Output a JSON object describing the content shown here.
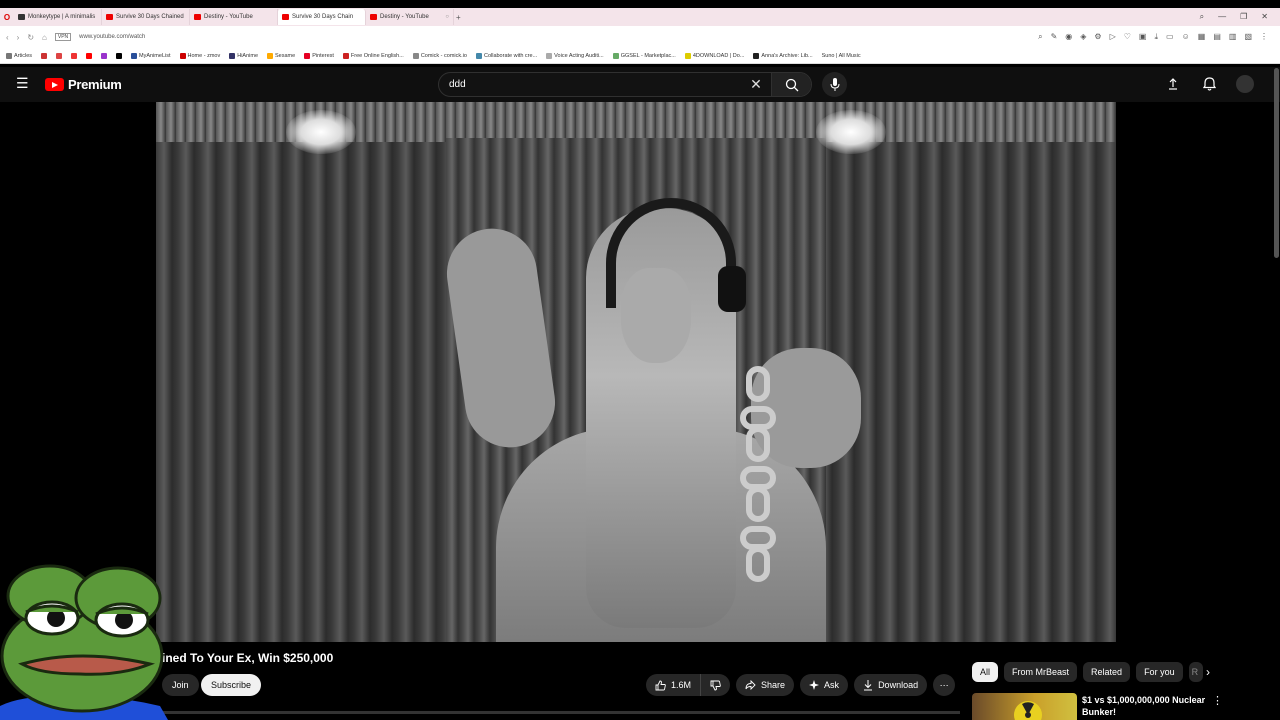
{
  "browser": {
    "tabs": [
      {
        "title": "Monkeytype | A minimalis",
        "active": false
      },
      {
        "title": "Survive 30 Days Chained",
        "active": false
      },
      {
        "title": "Destiny - YouTube",
        "active": false
      },
      {
        "title": "Survive 30 Days Chain",
        "active": true
      },
      {
        "title": "Destiny - YouTube",
        "active": false
      }
    ],
    "new_tab": "+",
    "url": "www.youtube.com/watch",
    "vpn_label": "VPN",
    "bookmarks": [
      "Articles",
      "MyAnimeList",
      "Home - zmov",
      "HiAnime",
      "Sesame",
      "Pinterest",
      "Free Online English...",
      "Comick - comick.io",
      "Collaborate with cre...",
      "Voice Acting Auditi...",
      "GGSEL - Marketplac...",
      "4DOWNLOAD | Do...",
      "Anna's Archive: Lib...",
      "Suno | All Music"
    ]
  },
  "youtube": {
    "logo_text": "Premium",
    "search": {
      "value": "ddd"
    },
    "video": {
      "title": "ined To Your Ex, Win $250,000",
      "join_label": "Join",
      "subscribe_label": "Subscribe",
      "like_count": "1.6M",
      "share_label": "Share",
      "ask_label": "Ask",
      "download_label": "Download"
    },
    "chips": [
      {
        "label": "All",
        "active": true
      },
      {
        "label": "From MrBeast",
        "active": false
      },
      {
        "label": "Related",
        "active": false
      },
      {
        "label": "For you",
        "active": false
      },
      {
        "label": "R",
        "active": false
      }
    ],
    "recommendation": {
      "title": "$1 vs $1,000,000,000 Nuclear Bunker!"
    }
  },
  "colors": {
    "brand_red": "#ff0000",
    "background": "#0f0f0f",
    "chip_bg": "#272727"
  }
}
